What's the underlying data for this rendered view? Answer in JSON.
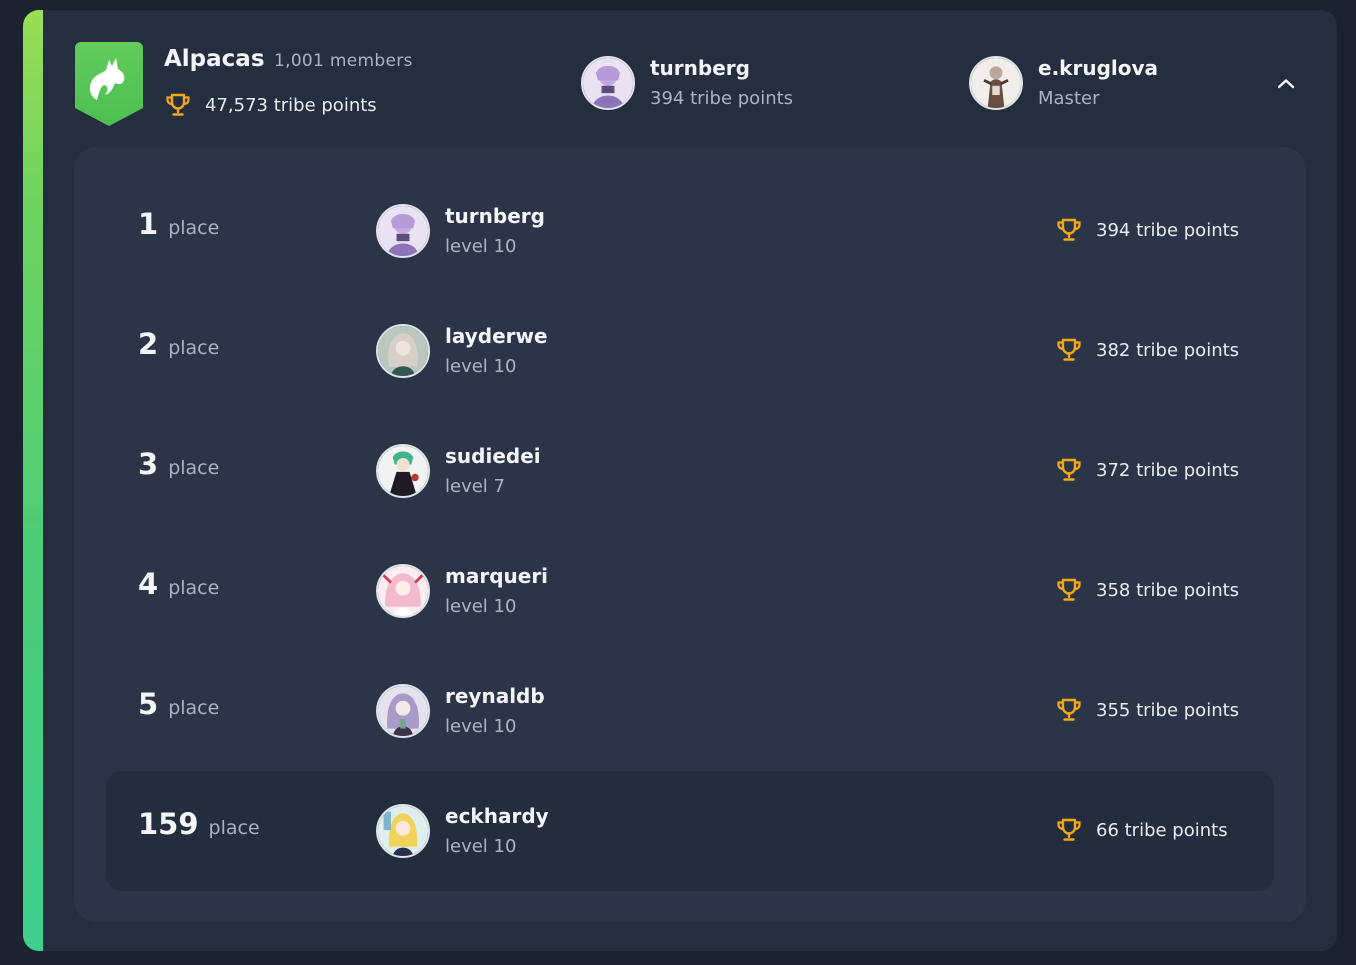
{
  "colors": {
    "accent_gradient_top": "#9ade55",
    "accent_gradient_bottom": "#3ecf8e",
    "trophy": "#f2a71b",
    "card_bg": "#252e3e",
    "panel_bg": "#2b3547"
  },
  "tribe": {
    "logo_icon": "alpaca-shield-icon",
    "name": "Alpacas",
    "members": "1,001 members",
    "points": "47,573 tribe points"
  },
  "top_user": {
    "name": "turnberg",
    "points": "394 tribe points"
  },
  "master": {
    "name": "e.kruglova",
    "role": "Master"
  },
  "collapse_icon": "chevron-up-icon",
  "leaderboard": {
    "place_word": "place",
    "rows": [
      {
        "rank": "1",
        "name": "turnberg",
        "level": "level 10",
        "points": "394 tribe points"
      },
      {
        "rank": "2",
        "name": "layderwe",
        "level": "level 10",
        "points": "382 tribe points"
      },
      {
        "rank": "3",
        "name": "sudiedei",
        "level": "level 7",
        "points": "372 tribe points"
      },
      {
        "rank": "4",
        "name": "marqueri",
        "level": "level 10",
        "points": "358 tribe points"
      },
      {
        "rank": "5",
        "name": "reynaldb",
        "level": "level 10",
        "points": "355 tribe points"
      },
      {
        "rank": "159",
        "name": "eckhardy",
        "level": "level 10",
        "points": "66 tribe points",
        "is_current_user": true
      }
    ]
  }
}
